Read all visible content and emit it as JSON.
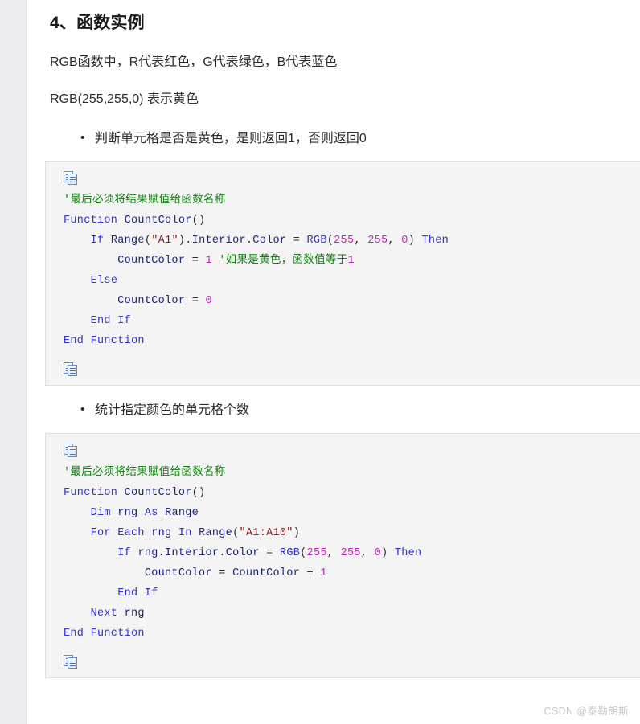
{
  "heading": "4、函数实例",
  "paragraphs": [
    "RGB函数中，R代表红色，G代表绿色，B代表蓝色",
    "RGB(255,255,0) 表示黄色"
  ],
  "bullets": [
    "判断单元格是否是黄色，是则返回1，否则返回0",
    "统计指定颜色的单元格个数"
  ],
  "code_blocks": [
    {
      "copy_icon_top": "copy-icon",
      "copy_icon_bottom": "copy-icon",
      "lines": [
        "'最后必须将结果赋值给函数名称",
        "Function CountColor()",
        "    If Range(\"A1\").Interior.Color = RGB(255, 255, 0) Then",
        "        CountColor = 1 '如果是黄色，函数值等于1",
        "    Else",
        "        CountColor = 0",
        "    End If",
        "End Function"
      ]
    },
    {
      "copy_icon_top": "copy-icon",
      "copy_icon_bottom": "copy-icon",
      "lines": [
        "'最后必须将结果赋值给函数名称",
        "Function CountColor()",
        "    Dim rng As Range",
        "    For Each rng In Range(\"A1:A10\")",
        "        If rng.Interior.Color = RGB(255, 255, 0) Then",
        "            CountColor = CountColor + 1",
        "        End If",
        "    Next rng",
        "End Function"
      ]
    }
  ],
  "watermark": "CSDN @泰勒朗斯",
  "colors": {
    "keyword": "#3131cf",
    "identifier": "#1a237e",
    "number": "#c820c8",
    "string": "#8b1a1a",
    "comment": "#108010",
    "code_background": "#f4f4f4",
    "rail_background": "#ececf1",
    "watermark": "#c9c9cf"
  }
}
